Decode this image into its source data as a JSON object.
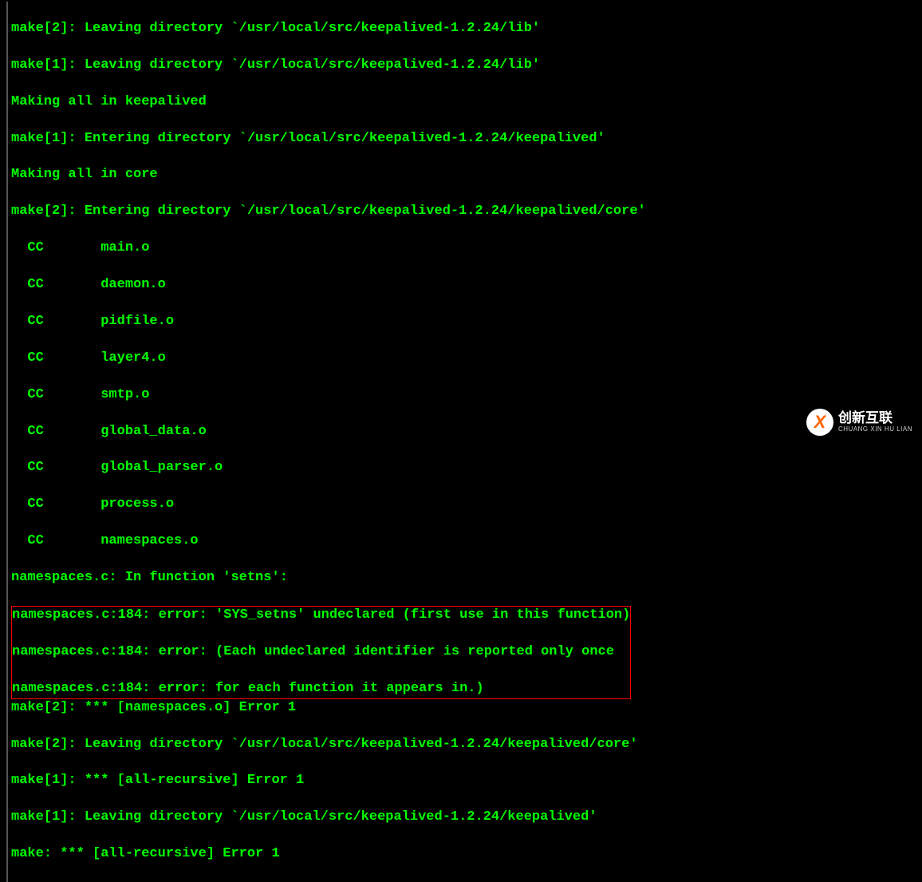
{
  "terminal": {
    "lines": [
      "make[2]: Leaving directory `/usr/local/src/keepalived-1.2.24/lib'",
      "make[1]: Leaving directory `/usr/local/src/keepalived-1.2.24/lib'",
      "Making all in keepalived",
      "make[1]: Entering directory `/usr/local/src/keepalived-1.2.24/keepalived'",
      "Making all in core",
      "make[2]: Entering directory `/usr/local/src/keepalived-1.2.24/keepalived/core'",
      "  CC       main.o",
      "  CC       daemon.o",
      "  CC       pidfile.o",
      "  CC       layer4.o",
      "  CC       smtp.o",
      "  CC       global_data.o",
      "  CC       global_parser.o",
      "  CC       process.o",
      "  CC       namespaces.o",
      "namespaces.c: In function 'setns':"
    ],
    "highlighted_errors": [
      "namespaces.c:184: error: 'SYS_setns' undeclared (first use in this function)",
      "namespaces.c:184: error: (Each undeclared identifier is reported only once",
      "namespaces.c:184: error: for each function it appears in.)"
    ],
    "lines_after": [
      "make[2]: *** [namespaces.o] Error 1",
      "make[2]: Leaving directory `/usr/local/src/keepalived-1.2.24/keepalived/core'",
      "make[1]: *** [all-recursive] Error 1",
      "make[1]: Leaving directory `/usr/local/src/keepalived-1.2.24/keepalived'",
      "make: *** [all-recursive] Error 1"
    ]
  },
  "watermark": {
    "icon_letter": "X",
    "cn": "创新互联",
    "en": "CHUANG XIN HU LIAN"
  }
}
